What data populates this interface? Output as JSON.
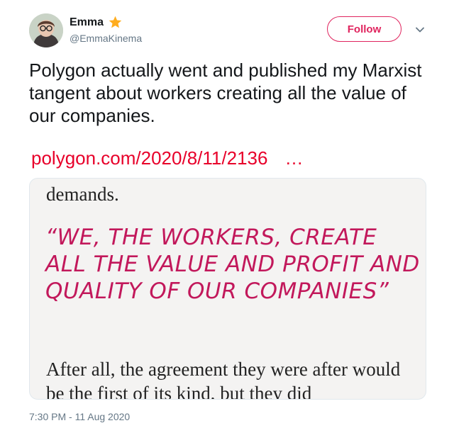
{
  "author": {
    "name": "Emma",
    "handle": "@EmmaKinema",
    "verified_icon": "star-icon"
  },
  "actions": {
    "follow_label": "Follow",
    "more_icon": "chevron-down-icon"
  },
  "tweet": {
    "text": "Polygon actually went and published my Marxist tangent about workers creating all the value of our companies.",
    "link_text": "polygon.com/2020/8/11/2136",
    "link_ellipsis": "…",
    "timestamp": "7:30 PM - 11 Aug 2020"
  },
  "card": {
    "top_text": "demands.",
    "pull_quote": "“WE, THE WORKERS, CREATE ALL THE VALUE AND PROFIT AND QUALITY OF OUR COMPANIES”",
    "body_text": "After all, the agreement they were after would be the first of its kind, but they did"
  },
  "colors": {
    "accent": "#e0245e",
    "link": "#e8002a",
    "quote": "#c2185b",
    "star": "#ffad1f",
    "muted": "#657786"
  }
}
